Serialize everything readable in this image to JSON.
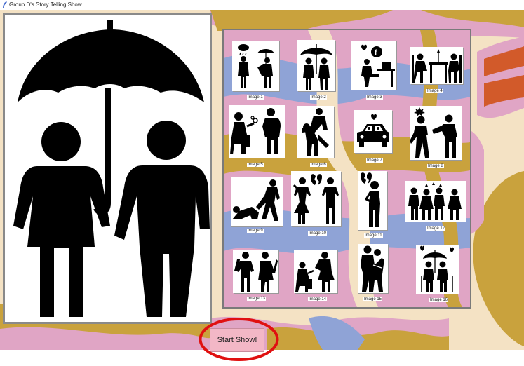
{
  "window": {
    "title": "Group D's Story Telling Show"
  },
  "thumbnails": [
    {
      "label": "Image 1"
    },
    {
      "label": "Image 2"
    },
    {
      "label": "Image 3"
    },
    {
      "label": "Image 4"
    },
    {
      "label": "Image 5"
    },
    {
      "label": "Image 6"
    },
    {
      "label": "Image 7"
    },
    {
      "label": "Image 8"
    },
    {
      "label": "Image 9"
    },
    {
      "label": "Image 10"
    },
    {
      "label": "Image 11"
    },
    {
      "label": "Image 12"
    },
    {
      "label": "Image 13"
    },
    {
      "label": "Image 14"
    },
    {
      "label": "Image 15"
    },
    {
      "label": "Image 16"
    }
  ],
  "start_button": {
    "label": "Start Show!",
    "color": "#f3b7c6"
  },
  "highlight": {
    "color": "#e01010"
  },
  "colors": {
    "wave_pink": "#e0a5c5",
    "wave_tan": "#c9a23d",
    "wave_blue": "#8fa3d6",
    "wave_cream": "#f4e2c4",
    "wave_orange": "#d25a2a"
  }
}
